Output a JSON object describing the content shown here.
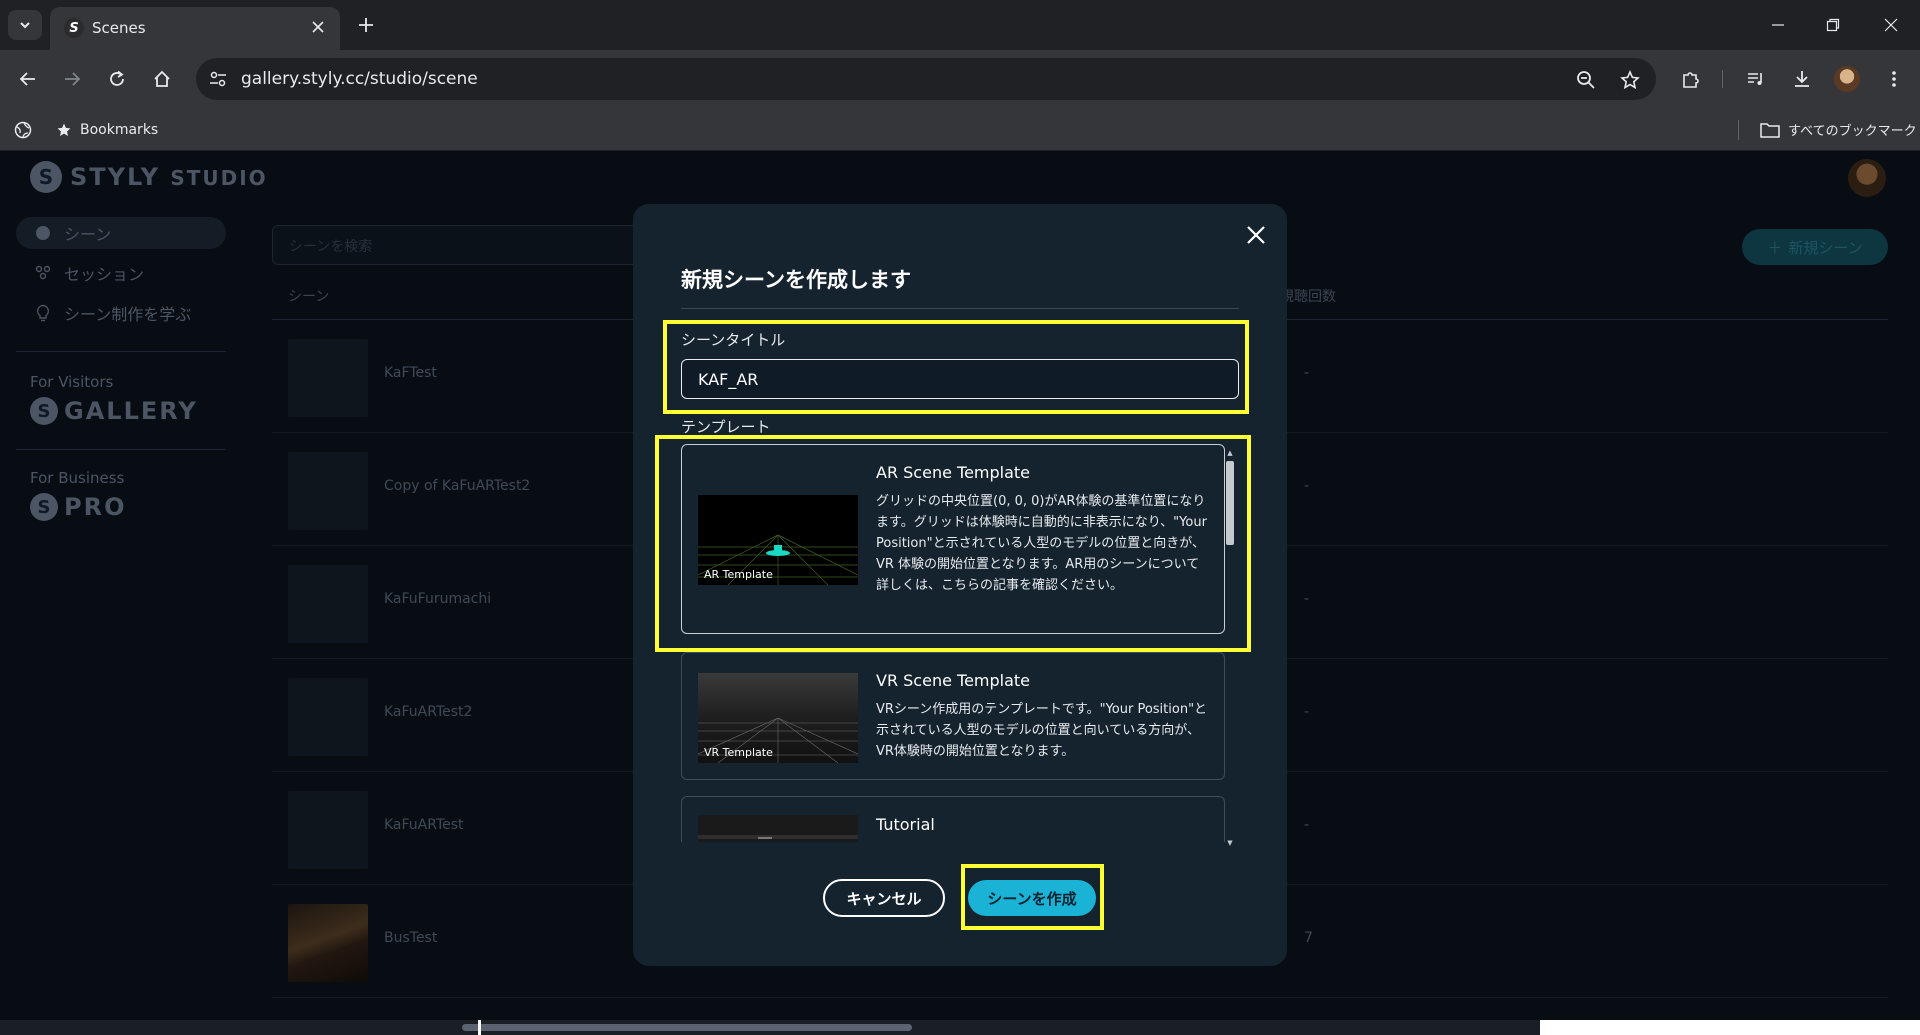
{
  "browser": {
    "tab_title": "Scenes",
    "favicon_letter": "S",
    "url": "gallery.styly.cc/studio/scene",
    "bookmarks_label": "Bookmarks",
    "all_bookmarks_label": "すべてのブックマーク"
  },
  "app": {
    "brand_main": "STYLY",
    "brand_sub": "STUDIO",
    "nav": [
      {
        "label": "シーン",
        "icon": "globe-icon"
      },
      {
        "label": "セッション",
        "icon": "people-icon"
      },
      {
        "label": "シーン制作を学ぶ",
        "icon": "bulb-icon"
      }
    ],
    "for_visitors_label": "For Visitors",
    "gallery_label": "GALLERY",
    "for_business_label": "For Business",
    "pro_label": "PRO",
    "search_placeholder": "シーンを検索",
    "new_scene_label": "新規シーン",
    "columns": {
      "scene": "シーン",
      "views": "視聴回数"
    },
    "rows": [
      {
        "name": "KaFTest",
        "views": "-"
      },
      {
        "name": "Copy of KaFuARTest2",
        "views": "-"
      },
      {
        "name": "KaFuFurumachi",
        "views": "-"
      },
      {
        "name": "KaFuARTest2",
        "views": "-"
      },
      {
        "name": "KaFuARTest",
        "views": "-"
      },
      {
        "name": "BusTest",
        "views": "7"
      }
    ]
  },
  "modal": {
    "title": "新規シーンを作成します",
    "scene_title_label": "シーンタイトル",
    "scene_title_value": "KAF_AR",
    "template_label": "テンプレート",
    "templates": [
      {
        "name": "AR Scene Template",
        "caption": "AR Template",
        "description": "グリッドの中央位置(0, 0, 0)がAR体験の基準位置になります。グリッドは体験時に自動的に非表示になり、\"Your Position\"と示されている人型のモデルの位置と向きが、VR 体験の開始位置となります。AR用のシーンについて詳しくは、こちらの記事を確認ください。",
        "selected": true
      },
      {
        "name": "VR Scene Template",
        "caption": "VR Template",
        "description": "VRシーン作成用のテンプレートです。\"Your Position\"と示されている人型のモデルの位置と向いている方向が、VR体験時の開始位置となります。",
        "selected": false
      },
      {
        "name": "Tutorial",
        "caption": "",
        "description": "",
        "selected": false
      }
    ],
    "cancel_label": "キャンセル",
    "create_label": "シーンを作成"
  },
  "colors": {
    "highlight": "#ffff33",
    "accent": "#1ab3d6",
    "modal_bg": "#15232f"
  }
}
